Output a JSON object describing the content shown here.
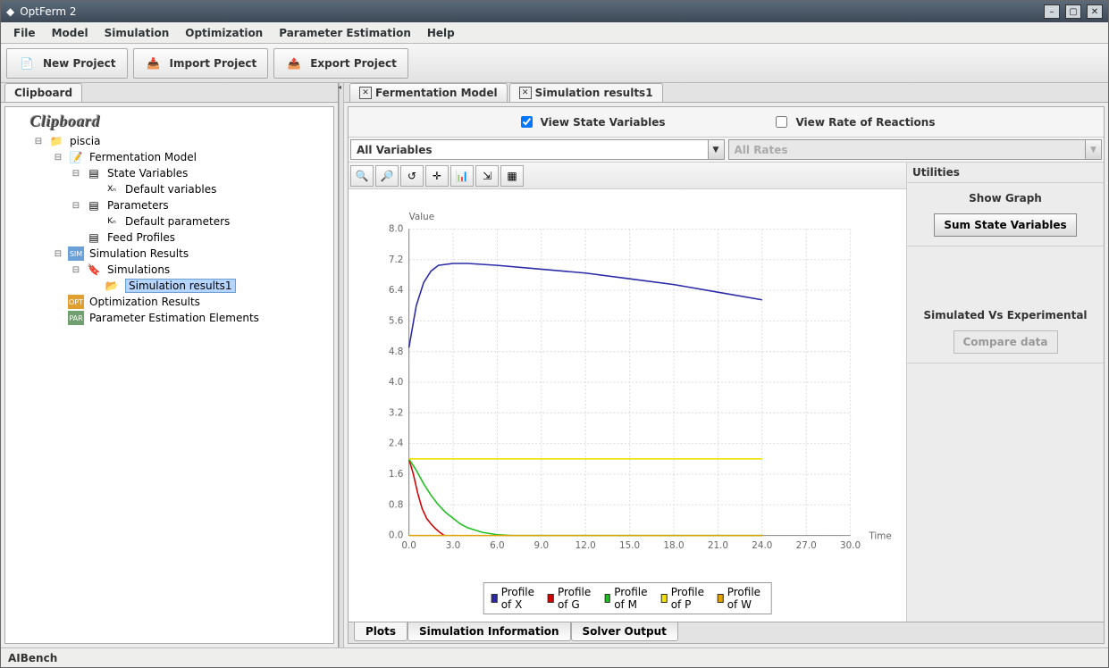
{
  "window": {
    "title": "OptFerm 2"
  },
  "menu": {
    "file": "File",
    "model": "Model",
    "simulation": "Simulation",
    "optimization": "Optimization",
    "paramest": "Parameter Estimation",
    "help": "Help"
  },
  "toolbar": {
    "new": "New Project",
    "import": "Import Project",
    "export": "Export Project"
  },
  "left_tab": {
    "clipboard": "Clipboard"
  },
  "tree": {
    "header": "Clipboard",
    "piscia": "piscia",
    "fmodel": "Fermentation Model",
    "statevars": "State Variables",
    "defvars": "Default variables",
    "params": "Parameters",
    "defparams": "Default parameters",
    "feed": "Feed Profiles",
    "simres": "Simulation Results",
    "sims": "Simulations",
    "simres1": "Simulation results1",
    "optres": "Optimization Results",
    "peelem": "Parameter Estimation Elements"
  },
  "tabs": {
    "fmodel": "Fermentation Model",
    "simres": "Simulation results1"
  },
  "checks": {
    "state": "View State Variables",
    "rate": "View Rate of Reactions"
  },
  "combos": {
    "vars": "All Variables",
    "rates": "All Rates"
  },
  "util": {
    "title": "Utilities",
    "showgraph": "Show Graph",
    "sumstate": "Sum State Variables",
    "simexp": "Simulated Vs Experimental",
    "compare": "Compare data"
  },
  "bottom": {
    "plots": "Plots",
    "siminfo": "Simulation Information",
    "solver": "Solver Output"
  },
  "status": {
    "text": "AIBench"
  },
  "chart_data": {
    "type": "line",
    "title": "",
    "xlabel": "Time",
    "ylabel": "Value",
    "xlim": [
      0,
      30
    ],
    "ylim": [
      0,
      8
    ],
    "x_ticks": [
      0.0,
      3.0,
      6.0,
      9.0,
      12.0,
      15.0,
      18.0,
      21.0,
      24.0,
      27.0,
      30.0
    ],
    "y_ticks": [
      0.0,
      0.8,
      1.6,
      2.4,
      3.2,
      4.0,
      4.8,
      5.6,
      6.4,
      7.2,
      8.0
    ],
    "series": [
      {
        "name": "Profile of X",
        "color": "#2a2aa8",
        "x": [
          0,
          0.5,
          1,
          1.5,
          2,
          3,
          4,
          6,
          9,
          12,
          15,
          18,
          21,
          24
        ],
        "y": [
          4.9,
          6.0,
          6.6,
          6.9,
          7.05,
          7.1,
          7.1,
          7.05,
          6.95,
          6.85,
          6.7,
          6.55,
          6.35,
          6.15
        ]
      },
      {
        "name": "Profile of G",
        "color": "#d40000",
        "x": [
          0,
          0.3,
          0.6,
          0.9,
          1.2,
          1.5,
          1.8,
          2.1,
          2.4
        ],
        "y": [
          2.0,
          1.6,
          1.1,
          0.7,
          0.45,
          0.3,
          0.18,
          0.08,
          0.0
        ]
      },
      {
        "name": "Profile of M",
        "color": "#1fbf1f",
        "x": [
          0,
          0.5,
          1,
          1.5,
          2,
          2.5,
          3,
          3.5,
          4,
          5,
          6,
          7,
          24
        ],
        "y": [
          2.0,
          1.7,
          1.35,
          1.05,
          0.8,
          0.6,
          0.45,
          0.3,
          0.2,
          0.08,
          0.02,
          0.0,
          0.0
        ]
      },
      {
        "name": "Profile of P",
        "color": "#f0e000",
        "x": [
          0,
          24
        ],
        "y": [
          2.0,
          2.0
        ]
      },
      {
        "name": "Profile of W",
        "color": "#e0a000",
        "x": [
          0,
          24
        ],
        "y": [
          0.0,
          0.0
        ]
      }
    ]
  }
}
